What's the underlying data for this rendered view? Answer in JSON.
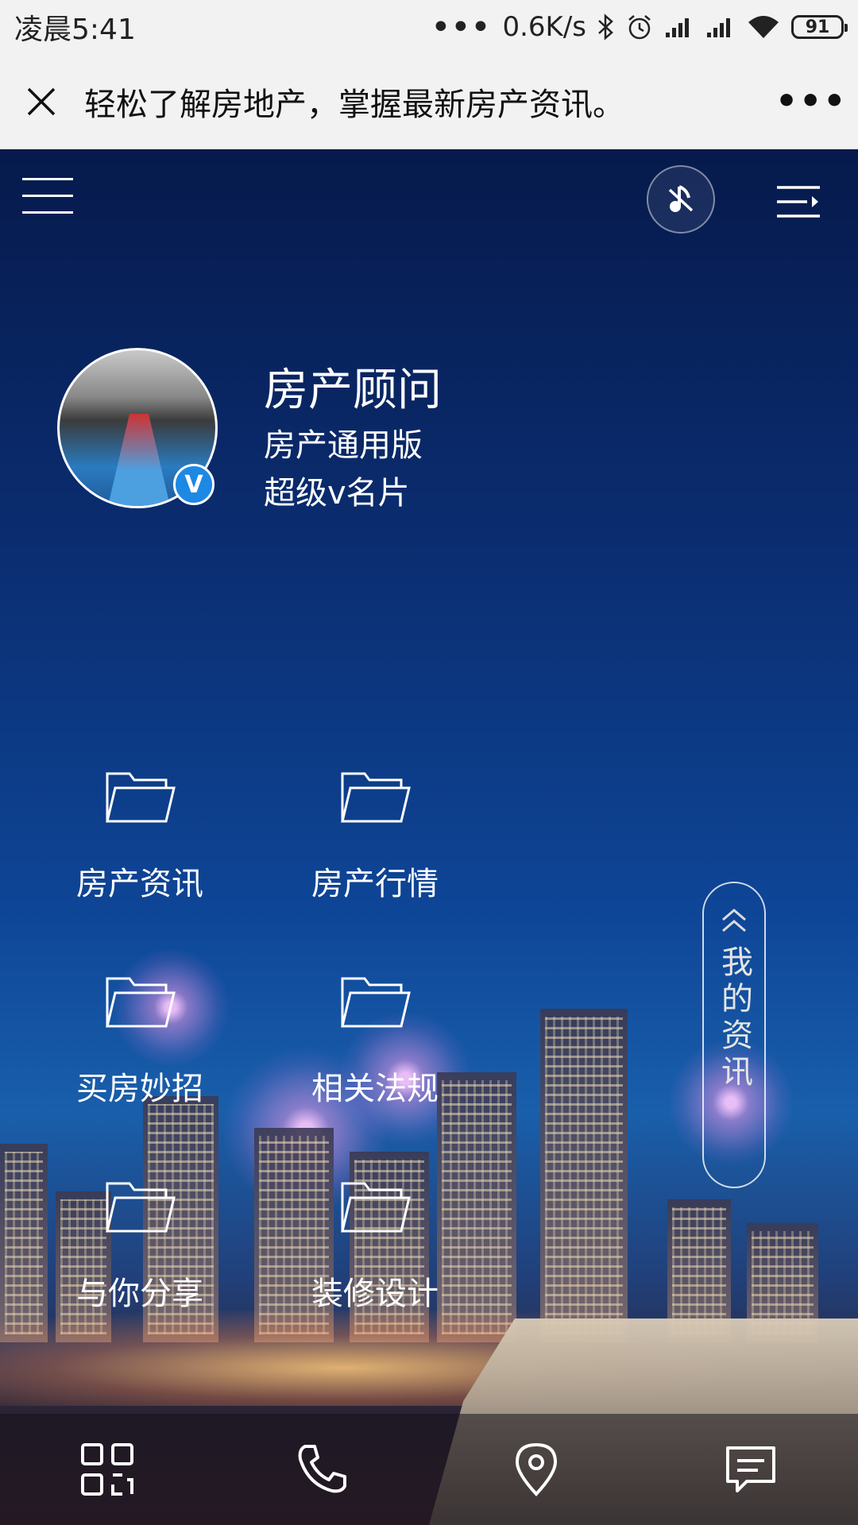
{
  "status_bar": {
    "time": "凌晨5:41",
    "dots": "•••",
    "net_speed": "0.6K/s",
    "battery": "91"
  },
  "title_bar": {
    "title": "轻松了解房地产，掌握最新房产资讯。",
    "more": "•••"
  },
  "profile": {
    "name": "房产顾问",
    "line1": "房产通用版",
    "line2": "超级v名片",
    "badge": "V"
  },
  "menu": {
    "items": [
      {
        "label": "房产资讯",
        "icon": "folder-icon"
      },
      {
        "label": "房产行情",
        "icon": "folder-icon"
      },
      {
        "label": "买房妙招",
        "icon": "folder-icon"
      },
      {
        "label": "相关法规",
        "icon": "folder-icon"
      },
      {
        "label": "与你分享",
        "icon": "folder-icon"
      },
      {
        "label": "装修设计",
        "icon": "folder-icon"
      }
    ]
  },
  "side_tab": {
    "label": "我的资讯"
  },
  "bottom_nav": {
    "items": [
      "qr-code-icon",
      "phone-icon",
      "location-icon",
      "message-icon"
    ]
  },
  "colors": {
    "accent_blue": "#1e88e5",
    "bar_bg": "#f2f2f2"
  }
}
